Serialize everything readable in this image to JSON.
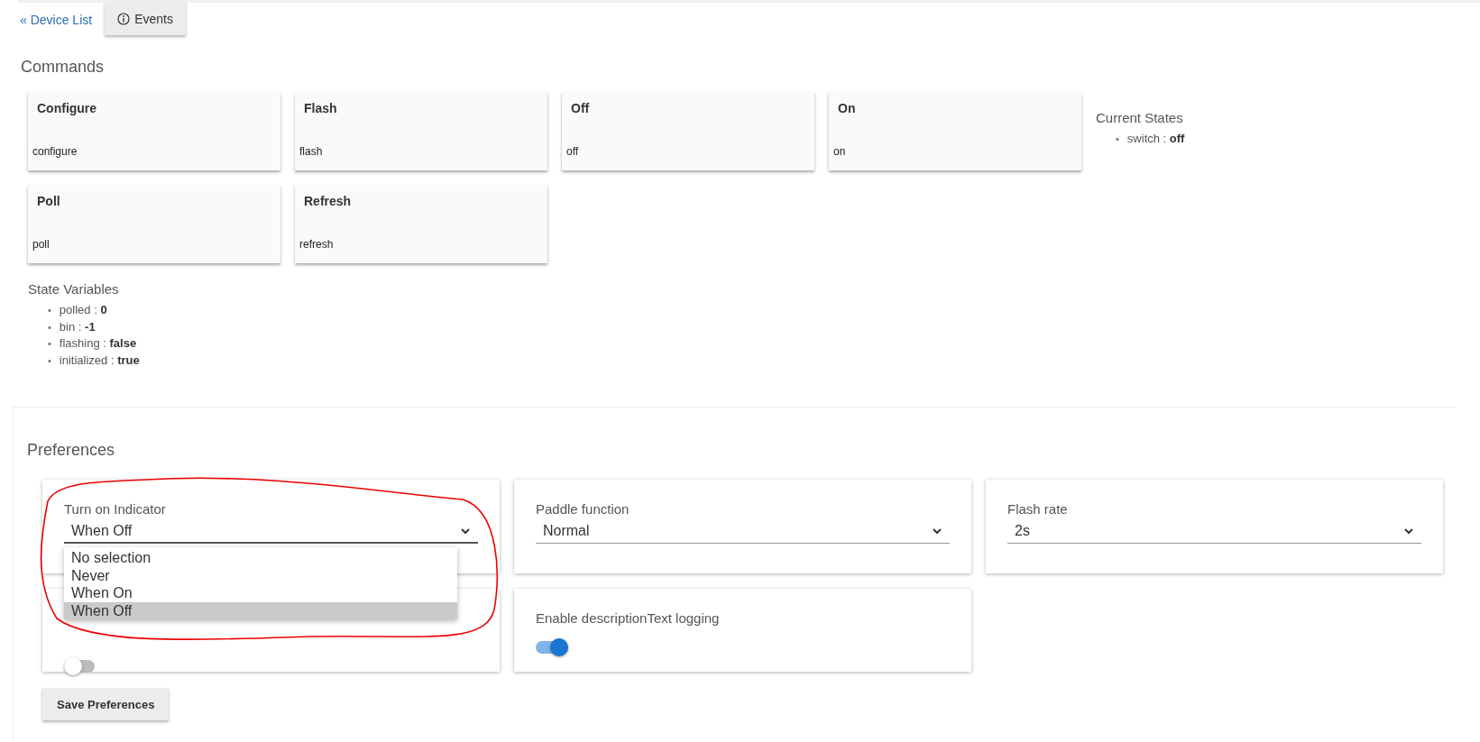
{
  "top_bar": {
    "back_link": "« Device List",
    "events_button": "Events"
  },
  "commands": {
    "title": "Commands",
    "items": [
      {
        "name": "Configure",
        "command": "configure"
      },
      {
        "name": "Flash",
        "command": "flash"
      },
      {
        "name": "Off",
        "command": "off"
      },
      {
        "name": "On",
        "command": "on"
      },
      {
        "name": "Poll",
        "command": "poll"
      },
      {
        "name": "Refresh",
        "command": "refresh"
      }
    ]
  },
  "current_states": {
    "title": "Current States",
    "items": [
      {
        "marker": "•",
        "text": "switch : **off**"
      }
    ]
  },
  "state_variables": {
    "title": "State Variables",
    "items": [
      {
        "marker": "•",
        "text": "polled : **0**"
      },
      {
        "marker": "•",
        "text": "bin : **-1**"
      },
      {
        "marker": "•",
        "text": "flashing : **false**"
      },
      {
        "marker": "•",
        "text": "initialized : **true**"
      }
    ]
  },
  "preferences": {
    "title": "Preferences",
    "items": [
      {
        "kind": "select",
        "label": "Turn on Indicator",
        "value": "When Off",
        "expanded": true,
        "options": [
          {
            "label": "No selection",
            "selected": false
          },
          {
            "label": "Never",
            "selected": false
          },
          {
            "label": "When On",
            "selected": false
          },
          {
            "label": "When Off",
            "selected": true
          }
        ]
      },
      {
        "kind": "select",
        "label": "Paddle function",
        "value": "Normal",
        "expanded": false
      },
      {
        "kind": "select",
        "label": "Flash rate",
        "value": "2s",
        "expanded": false
      },
      {
        "kind": "toggle",
        "on": false
      },
      {
        "kind": "toggle",
        "label": "Enable descriptionText logging",
        "on": true
      }
    ],
    "save_button": "Save Preferences"
  },
  "annotations": [
    {
      "kind": "freehand-circle"
    }
  ]
}
